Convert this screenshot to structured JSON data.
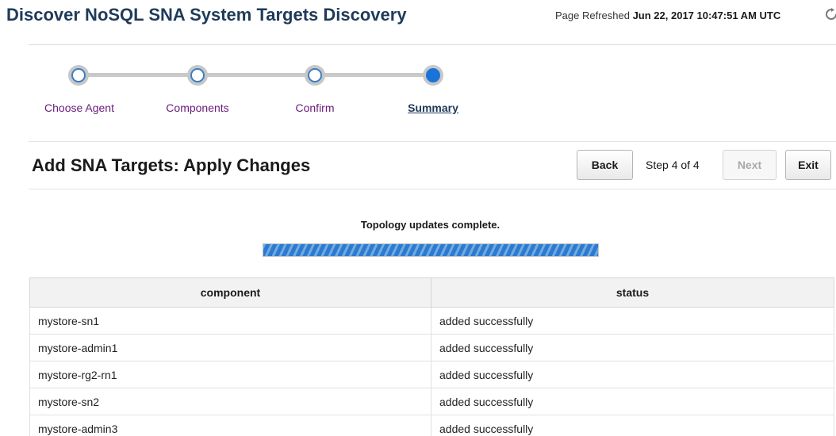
{
  "header": {
    "title": "Discover NoSQL SNA System Targets Discovery",
    "refreshed_label": "Page Refreshed",
    "refreshed_time": "Jun 22, 2017 10:47:51 AM UTC",
    "refresh_icon": "refresh-icon"
  },
  "train": {
    "steps": [
      {
        "label": "Choose Agent",
        "state": "visited"
      },
      {
        "label": "Components",
        "state": "visited"
      },
      {
        "label": "Confirm",
        "state": "visited"
      },
      {
        "label": "Summary",
        "state": "current"
      }
    ],
    "colors": {
      "link": "#6a1b7a",
      "current": "#1a73d9"
    }
  },
  "section": {
    "title": "Add SNA Targets: Apply Changes",
    "back_label": "Back",
    "step_text": "Step 4 of 4",
    "next_label": "Next",
    "exit_label": "Exit"
  },
  "progress": {
    "message": "Topology updates complete.",
    "percent": 100,
    "color": "#2b7bd0"
  },
  "table": {
    "columns": [
      "component",
      "status"
    ],
    "rows": [
      [
        "mystore-sn1",
        "added successfully"
      ],
      [
        "mystore-admin1",
        "added successfully"
      ],
      [
        "mystore-rg2-rn1",
        "added successfully"
      ],
      [
        "mystore-sn2",
        "added successfully"
      ],
      [
        "mystore-admin3",
        "added successfully"
      ]
    ]
  }
}
